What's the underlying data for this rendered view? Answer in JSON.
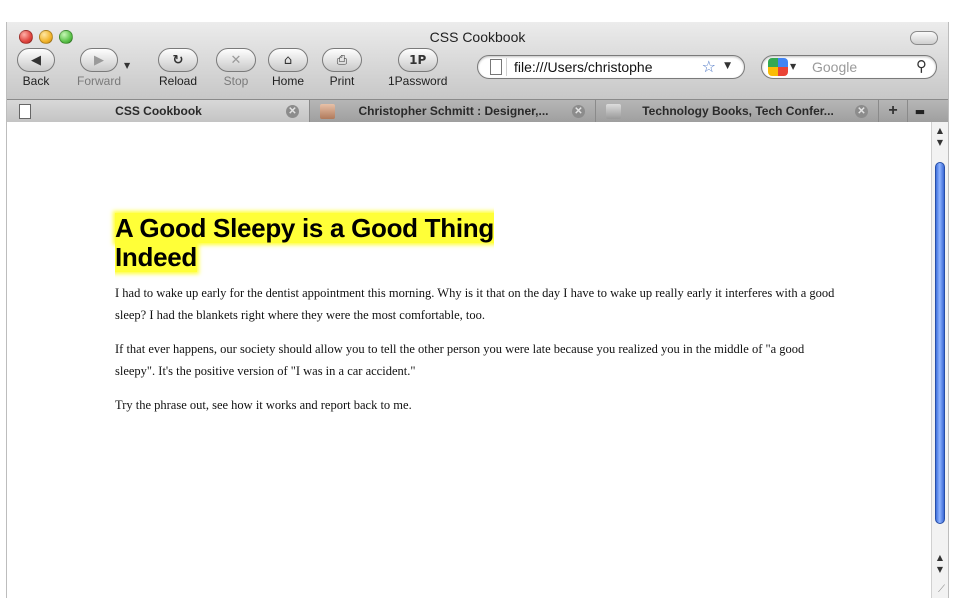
{
  "window": {
    "title": "CSS Cookbook"
  },
  "toolbar": {
    "back_label": "Back",
    "forward_label": "Forward",
    "reload_label": "Reload",
    "stop_label": "Stop",
    "home_label": "Home",
    "print_label": "Print",
    "onepassword_label": "1Password",
    "onepassword_icon_text": "1P"
  },
  "address_bar": {
    "url": "file:///Users/christophe"
  },
  "search": {
    "placeholder": "Google"
  },
  "tabs": [
    {
      "label": "CSS Cookbook",
      "active": true
    },
    {
      "label": "Christopher Schmitt : Designer,...",
      "active": false
    },
    {
      "label": "Technology Books, Tech Confer...",
      "active": false
    }
  ],
  "page": {
    "heading": "A Good Sleepy is a Good Thing Indeed",
    "paragraphs": [
      "I had to wake up early for the dentist appointment this morning. Why is it that on the day I have to wake up really early it interferes with a good sleep? I had the blankets right where they were the most comfortable, too.",
      "If that ever happens, our society should allow you to tell the other person you were late because you realized you in the middle of \"a good sleepy\". It's the positive version of \"I was in a car accident.\"",
      "Try the phrase out, see how it works and report back to me."
    ]
  },
  "colors": {
    "highlight": "#ffff38",
    "scroll_thumb": "#5a86e8"
  }
}
